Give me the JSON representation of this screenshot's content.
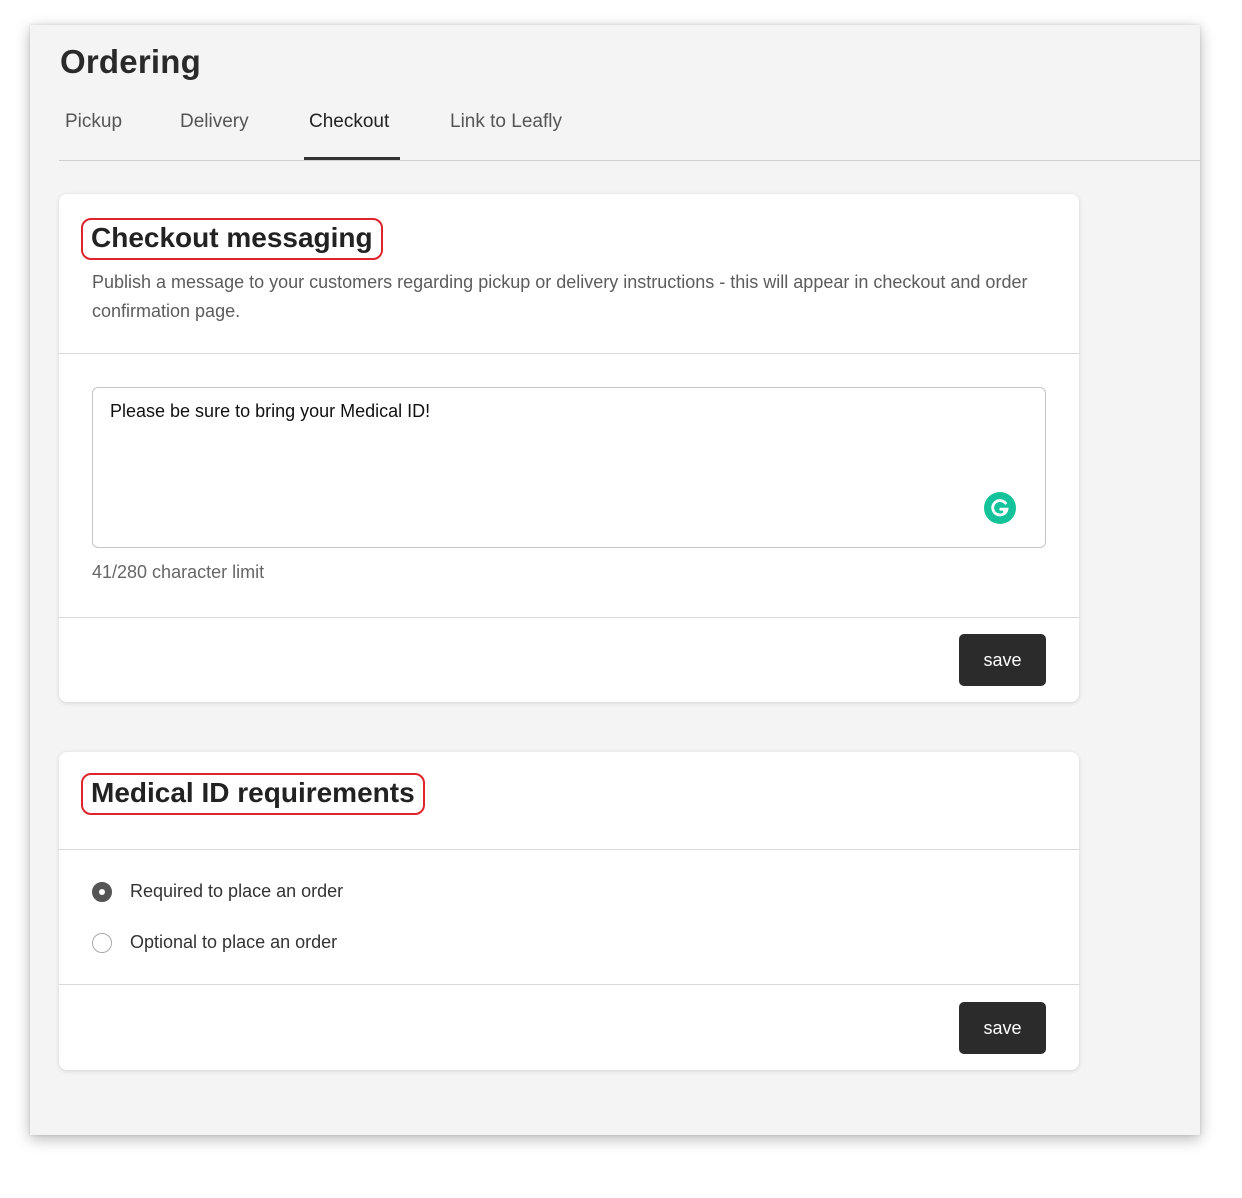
{
  "page": {
    "title": "Ordering"
  },
  "tabs": [
    {
      "label": "Pickup",
      "active": false
    },
    {
      "label": "Delivery",
      "active": false
    },
    {
      "label": "Checkout",
      "active": true
    },
    {
      "label": "Link to Leafly",
      "active": false
    }
  ],
  "checkout_messaging": {
    "title": "Checkout messaging",
    "description": "Publish a message to your customers regarding pickup or delivery instructions - this will appear in checkout and order confirmation page.",
    "message_value": "Please be sure to bring your Medical ID!",
    "char_limit_text": "41/280 character limit",
    "save_label": "save"
  },
  "medical_id": {
    "title": "Medical ID requirements",
    "options": [
      {
        "label": "Required to place an order",
        "selected": true
      },
      {
        "label": "Optional to place an order",
        "selected": false
      }
    ],
    "save_label": "save"
  },
  "colors": {
    "highlight_border": "#e0242b",
    "button_bg": "#2b2b2b",
    "grammarly_green": "#15c39a",
    "page_bg": "#f4f4f4"
  },
  "icons": {
    "grammarly": "grammarly-icon"
  }
}
